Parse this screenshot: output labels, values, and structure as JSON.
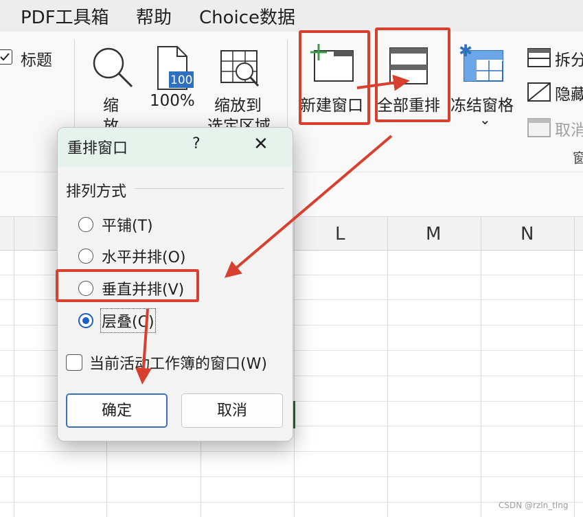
{
  "menubar": {
    "items": [
      "PDF工具箱",
      "帮助",
      "Choice数据"
    ]
  },
  "ribbon": {
    "show_group": {
      "title_checkbox_label": "标题"
    },
    "zoom_group": {
      "zoom_label_line1": "缩",
      "zoom_label_line2": "放",
      "zoom100_label": "100%",
      "zoom100_icon_text": "100",
      "zoom_selection_line1": "缩放到",
      "zoom_selection_line2": "选定区域"
    },
    "window_group": {
      "new_window_label": "新建窗口",
      "arrange_all_label": "全部重排",
      "freeze_panes_label": "冻结窗格",
      "freeze_chevron": "⌄",
      "split_label": "拆分",
      "hide_label": "隐藏",
      "unhide_label": "取消",
      "group_caption": "窗"
    }
  },
  "sheet": {
    "column_headers": [
      "L",
      "M",
      "N"
    ]
  },
  "dialog": {
    "title": "重排窗口",
    "help": "?",
    "close": "✕",
    "group_label": "排列方式",
    "options": [
      {
        "label": "平铺(T)",
        "selected": false
      },
      {
        "label": "水平并排(O)",
        "selected": false
      },
      {
        "label": "垂直并排(V)",
        "selected": false
      },
      {
        "label": "层叠(C)",
        "selected": true
      }
    ],
    "checkbox_label": "当前活动工作簿的窗口(W)",
    "checkbox_checked": false,
    "ok_label": "确定",
    "cancel_label": "取消"
  },
  "annotation_color": "#d7402f",
  "accent_color": "#1f5fc4",
  "watermark": "CSDN @rzln_tlng"
}
